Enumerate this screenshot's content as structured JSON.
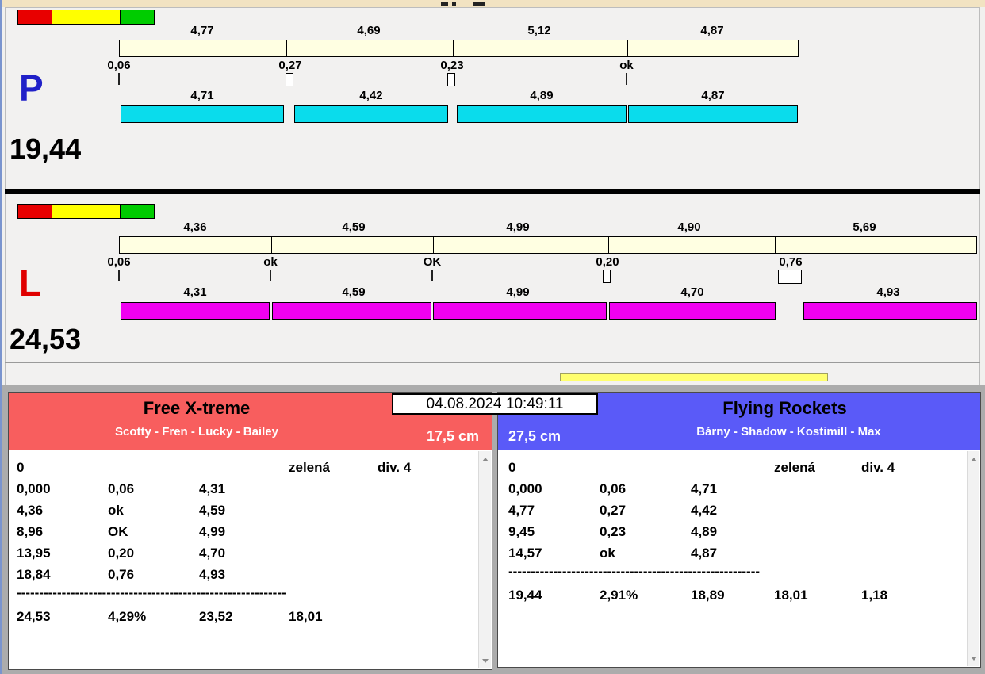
{
  "colors": {
    "cyan": "#0ADCEC",
    "magenta": "#F000F0",
    "cream": "#FFFFE2",
    "red-header": "#F85E5E",
    "blue-header": "#5A5AF8",
    "light-red": "#E80000",
    "light-yellow": "#FFFF00",
    "light-green": "#00CC00",
    "p-letter": "#2020C8",
    "l-letter": "#E00000",
    "yellow-bar": "#FFFF6E"
  },
  "timestamp": "04.08.2024 10:49:11",
  "lane_p": {
    "letter": "P",
    "total": "19,44",
    "top_splits": [
      "4,77",
      "4,69",
      "5,12",
      "4,87"
    ],
    "mark_labels": [
      "0,06",
      "0,27",
      "0,23",
      "ok"
    ],
    "bottom_splits": [
      "4,71",
      "4,42",
      "4,89",
      "4,87"
    ]
  },
  "lane_l": {
    "letter": "L",
    "total": "24,53",
    "top_splits": [
      "4,36",
      "4,59",
      "4,99",
      "4,90",
      "5,69"
    ],
    "mark_labels": [
      "0,06",
      "ok",
      "OK",
      "0,20",
      "0,76"
    ],
    "bottom_splits": [
      "4,31",
      "4,59",
      "4,99",
      "4,70",
      "4,93"
    ]
  },
  "team_left": {
    "name": "Free X-treme",
    "members": "Scotty - Fren - Lucky - Bailey",
    "jump_height": "17,5 cm",
    "rows": [
      [
        "0",
        "",
        "",
        "zelená",
        "div. 4"
      ],
      [
        "0,000",
        "0,06",
        "4,31",
        "",
        ""
      ],
      [
        "4,36",
        "ok",
        "4,59",
        "",
        ""
      ],
      [
        "8,96",
        "OK",
        "4,99",
        "",
        ""
      ],
      [
        "13,95",
        "0,20",
        "4,70",
        "",
        ""
      ],
      [
        "18,84",
        "0,76",
        "4,93",
        "",
        ""
      ]
    ],
    "separator": "------------------------------------------------------------",
    "summary": [
      "24,53",
      "4,29%",
      "23,52",
      "18,01",
      ""
    ]
  },
  "team_right": {
    "name": "Flying Rockets",
    "members": "Bárny - Shadow - Kostimill - Max",
    "jump_height": "27,5 cm",
    "rows": [
      [
        "0",
        "",
        "",
        "zelená",
        "div. 4"
      ],
      [
        "0,000",
        "0,06",
        "4,71",
        "",
        ""
      ],
      [
        "4,77",
        "0,27",
        "4,42",
        "",
        ""
      ],
      [
        "9,45",
        "0,23",
        "4,89",
        "",
        ""
      ],
      [
        "14,57",
        "ok",
        "4,87",
        "",
        ""
      ]
    ],
    "separator": "--------------------------------------------------------",
    "summary": [
      "19,44",
      "2,91%",
      "18,89",
      "18,01",
      "1,18"
    ]
  }
}
